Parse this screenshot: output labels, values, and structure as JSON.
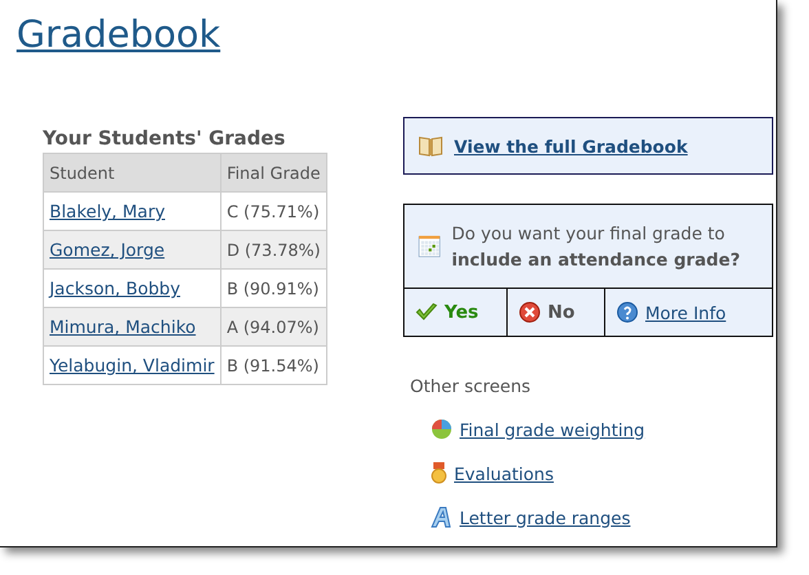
{
  "title": "Gradebook",
  "grades": {
    "heading": "Your Students' Grades",
    "columns": [
      "Student",
      "Final Grade"
    ],
    "rows": [
      {
        "student": "Blakely, Mary",
        "grade": "C (75.71%)"
      },
      {
        "student": "Gomez, Jorge",
        "grade": "D (73.78%)"
      },
      {
        "student": "Jackson, Bobby",
        "grade": "B (90.91%)"
      },
      {
        "student": "Mimura, Machiko",
        "grade": "A (94.07%)"
      },
      {
        "student": "Yelabugin, Vladimir",
        "grade": "B (91.54%)"
      }
    ]
  },
  "full_gradebook_link": "View the full Gradebook",
  "attendance": {
    "question": "Do you want your final grade to **include an attendance grade?**",
    "options": [
      {
        "kind": "yes",
        "label": "Yes"
      },
      {
        "kind": "no",
        "label": "No"
      },
      {
        "kind": "info",
        "label": "More Info"
      }
    ]
  },
  "other_screens": {
    "heading": "Other screens",
    "links": [
      {
        "kind": "pie",
        "label": "Final grade weighting"
      },
      {
        "kind": "medal",
        "label": "Evaluations"
      },
      {
        "kind": "letter",
        "label": "Letter grade ranges"
      }
    ]
  }
}
